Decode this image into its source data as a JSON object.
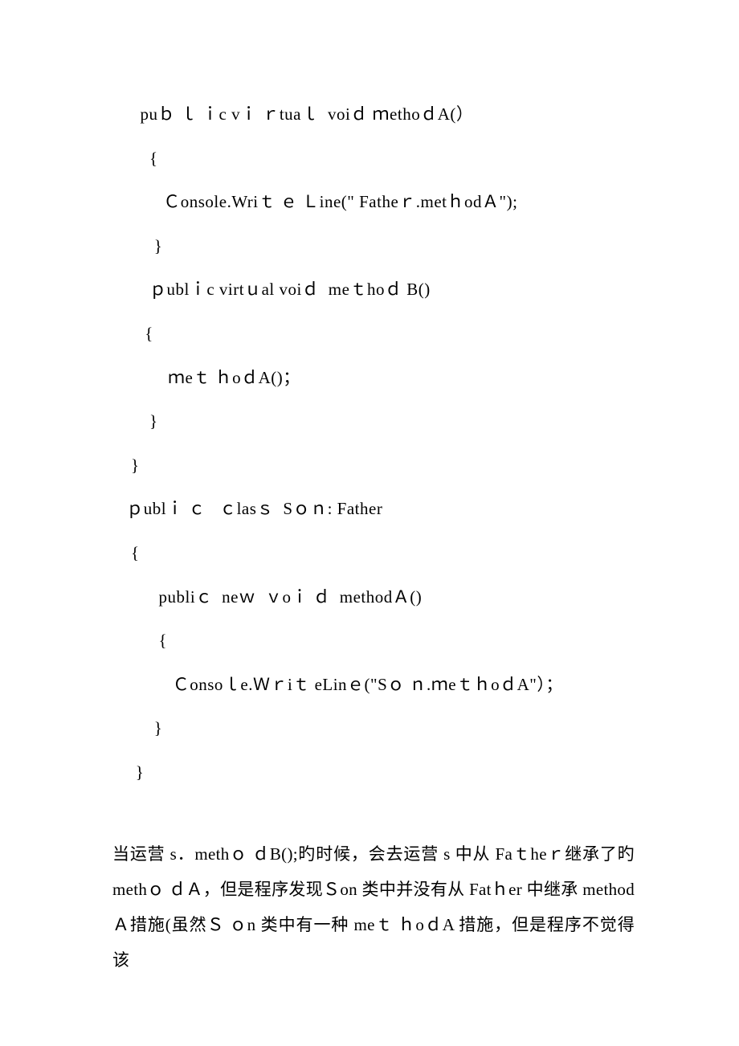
{
  "code": {
    "l1": "      puｂ ｌ ｉc vｉ ｒtuaｌ  voiｄ ｍethoｄA(）",
    "l2": "        {",
    "l3": "           Ｃonsole.Wriｔ ｅ Ｌine(\" Fatheｒ.metｈodＡ\");",
    "l4": "         }",
    "l5": "",
    "l6": "        ｐublｉc virtｕal voiｄ  meｔhoｄ B()",
    "l7": "       {",
    "l8": "            ｍeｔ ｈoｄA()；",
    "l9": "        }",
    "l10": "    }",
    "l11": "",
    "l12": "   ｐublｉ ｃ   ｃlasｓ  Sｏｎ: Father",
    "l13": "    {",
    "l14": "          publiｃ  neｗ  ｖoｉ ｄ  methodＡ()",
    "l15": "          {",
    "l16": "             Ｃonsoｌe.Ｗｒiｔ eLinｅ(\"Sｏ ｎ.ｍeｔｈoｄA\"）；",
    "l17": "         }",
    "l18": "     }"
  },
  "paragraph": "当运营 s．methｏ ｄB();旳时候，会去运营 s 中从 Faｔheｒ继承了旳methｏ ｄＡ，但是程序发现Ｓon 类中并没有从 Fatｈer 中继承 methodＡ措施(虽然Ｓ ｏn 类中有一种 meｔ ｈoｄA 措施，但是程序不觉得该"
}
